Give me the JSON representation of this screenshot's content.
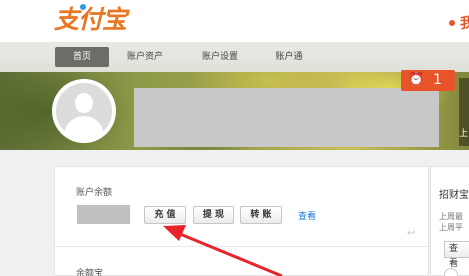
{
  "header": {
    "logo_text": "支付宝",
    "top_right_text": "我"
  },
  "nav": {
    "items": [
      {
        "label": "首页",
        "active": true
      },
      {
        "label": "账户资产",
        "active": false
      },
      {
        "label": "账户设置",
        "active": false
      },
      {
        "label": "账户通",
        "active": false
      }
    ]
  },
  "banner": {
    "alarm_count": "1",
    "alarm_icon": "alarm-clock-icon",
    "side_text": "上"
  },
  "account": {
    "balance_label": "账户余额",
    "recharge_label": "充 值",
    "withdraw_label": "提 现",
    "transfer_label": "转 账",
    "view_link": "查看",
    "next_section_label": "余额宝"
  },
  "side_card": {
    "title": "招财宝",
    "line1": "上周最",
    "line2": "上周平",
    "button_label": "查 看"
  },
  "colors": {
    "brand_orange": "#e87723",
    "alert_red": "#e8542a",
    "link_blue": "#1a7bd3",
    "annotation_arrow": "#e8232a"
  }
}
